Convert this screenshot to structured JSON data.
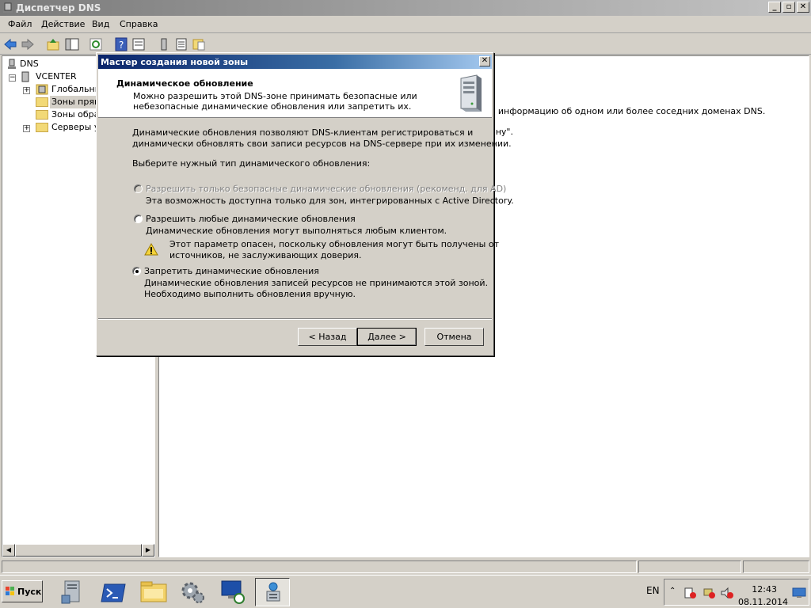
{
  "window": {
    "title": "Диспетчер DNS",
    "minimize": "_",
    "maximize": "▫",
    "close": "✕"
  },
  "menu": {
    "file": "Файл",
    "action": "Действие",
    "view": "Вид",
    "help": "Справка"
  },
  "tree": {
    "root": "DNS",
    "server": "VCENTER",
    "items": [
      "Глобальны",
      "Зоны прямо",
      "Зоны обрат",
      "Серверы ус"
    ]
  },
  "right_pane": {
    "line1": "т информацию об одном или более соседних доменах DNS.",
    "line2": "ону\"."
  },
  "dialog": {
    "title": "Мастер создания новой зоны",
    "close": "✕",
    "header_title": "Динамическое обновление",
    "header_sub": "Можно разрешить этой DNS-зоне принимать безопасные или небезопасные динамические обновления или запретить их.",
    "intro1": "Динамические обновления позволяют DNS-клиентам регистрироваться и",
    "intro2": "динамически обновлять свои записи ресурсов на DNS-сервере при их изменении.",
    "choose": "Выберите нужный тип динамического обновления:",
    "options": [
      {
        "label": "Разрешить только безопасные динамические обновления (рекоменд. для AD)",
        "desc1": "Эта возможность доступна только для зон, интегрированных с Active Directory.",
        "desc2": "",
        "checked": false,
        "disabled": true
      },
      {
        "label": "Разрешить любые динамические обновления",
        "desc1": "Динамические обновления могут выполняться любым клиентом.",
        "desc2": "",
        "checked": false,
        "disabled": false
      },
      {
        "label": "Запретить динамические обновления",
        "desc1": "Динамические обновления записей ресурсов не принимаются этой зоной.",
        "desc2": "Необходимо выполнить обновления вручную.",
        "checked": true,
        "disabled": false
      }
    ],
    "warning1": "Этот параметр опасен, поскольку обновления могут быть получены от",
    "warning2": "источников, не заслуживающих доверия.",
    "buttons": {
      "back": "< Назад",
      "next": "Далее >",
      "cancel": "Отмена"
    }
  },
  "taskbar": {
    "start": "Пуск",
    "lang": "EN",
    "time": "12:43",
    "date": "08.11.2014"
  },
  "icons": [
    "dns-server-icon",
    "back-icon",
    "forward-icon",
    "up-folder-icon",
    "show-hide-tree-icon",
    "refresh-icon",
    "help-icon",
    "properties-icon",
    "server-manager-icon",
    "powershell-icon",
    "explorer-icon",
    "settings-icon",
    "remote-desktop-icon",
    "dns-manager-icon",
    "warning-icon"
  ]
}
